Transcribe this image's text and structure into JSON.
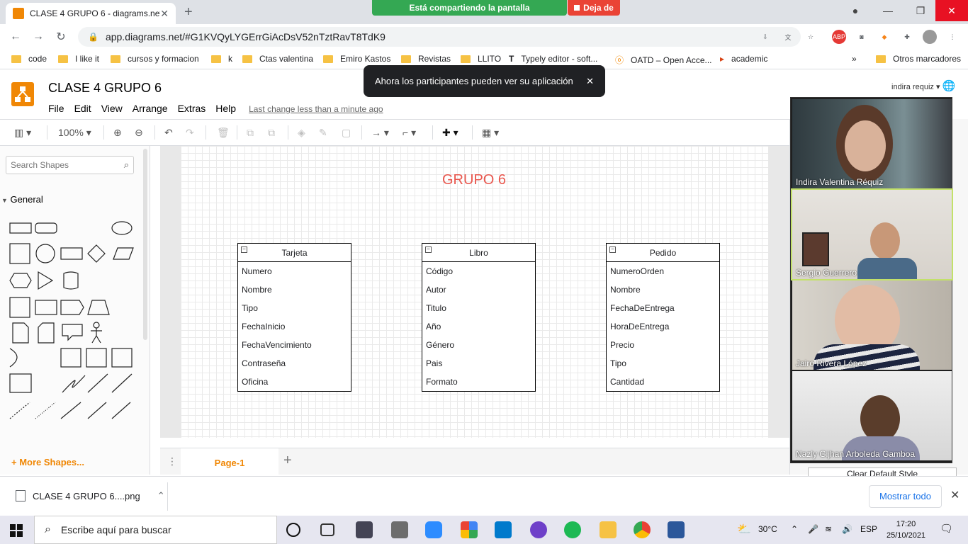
{
  "browser": {
    "tab_title": "CLASE 4 GRUPO 6 - diagrams.net",
    "url": "app.diagrams.net/#G1KVQyLYGErrGiAcDsV52nTztRavT8TdK9",
    "sharing_text": "Está compartiendo la pantalla",
    "stop_sharing_text": "Deja de"
  },
  "bookmarks": [
    "code",
    "I like it",
    "cursos y formacion",
    "k",
    "Ctas valentina",
    "Emiro Kastos",
    "Revistas",
    "LLITO",
    "Typely editor - soft...",
    "OATD – Open Acce...",
    "academic",
    "Otros marcadores"
  ],
  "toast": {
    "message": "Ahora los participantes pueden ver su aplicación"
  },
  "app": {
    "doc_title": "CLASE 4 GRUPO 6",
    "menu": [
      "File",
      "Edit",
      "View",
      "Arrange",
      "Extras",
      "Help"
    ],
    "last_change": "Last change less than a minute ago",
    "user": "indira requiz",
    "zoom": "100%"
  },
  "sidebar": {
    "search_placeholder": "Search Shapes",
    "section": "General",
    "more_shapes": "+ More Shapes..."
  },
  "diagram": {
    "title": "GRUPO 6",
    "entities": [
      {
        "name": "Tarjeta",
        "fields": [
          "Numero",
          "Nombre",
          "Tipo",
          "FechaInicio",
          "FechaVencimiento",
          "Contraseña",
          "Oficina"
        ]
      },
      {
        "name": "Libro",
        "fields": [
          "Código",
          "Autor",
          "Titulo",
          "Año",
          "Género",
          "Pais",
          "Formato"
        ]
      },
      {
        "name": "Pedido",
        "fields": [
          "NumeroOrden",
          "Nombre",
          "FechaDeEntrega",
          "HoraDeEntrega",
          "Precio",
          "Tipo",
          "Cantidad"
        ]
      }
    ]
  },
  "pages": {
    "current": "Page-1"
  },
  "right_panel": {
    "clear_default_style": "Clear Default Style"
  },
  "participants": [
    "Indira Valentina Réquiz",
    "Sergio Guerrero",
    "Jairo Rivera López",
    "Nazly Gijhan Arboleda Gamboa"
  ],
  "downloads": {
    "file": "CLASE 4 GRUPO 6....png",
    "show_all": "Mostrar todo"
  },
  "taskbar": {
    "search_text": "Escribe aquí para buscar",
    "temperature": "30°C",
    "language": "ESP",
    "time": "17:20",
    "date": "25/10/2021"
  },
  "colors": {
    "drawio_orange": "#f08705",
    "group_title": "#e9574e",
    "sharing_green": "#34a853",
    "stop_red": "#ea4335"
  }
}
